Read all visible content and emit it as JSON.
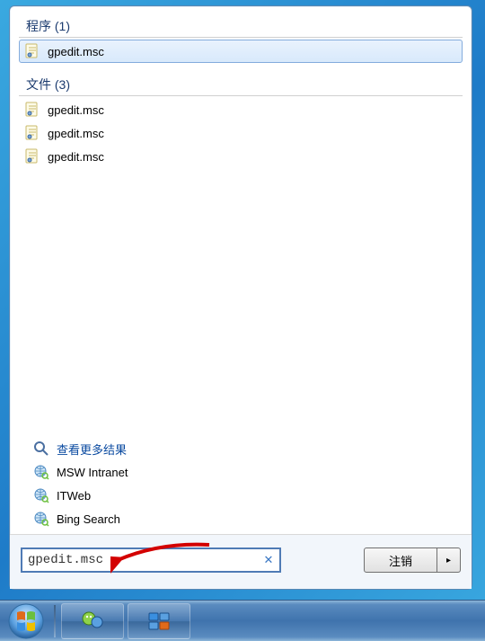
{
  "sections": {
    "programs": {
      "header": "程序 (1)",
      "items": [
        "gpedit.msc"
      ]
    },
    "files": {
      "header": "文件 (3)",
      "items": [
        "gpedit.msc",
        "gpedit.msc",
        "gpedit.msc"
      ]
    }
  },
  "bottom_links": {
    "more_results": "查看更多结果",
    "msw": "MSW Intranet",
    "itweb": "ITWeb",
    "bing": "Bing Search"
  },
  "search": {
    "value": "gpedit.msc"
  },
  "shutdown": {
    "label": "注销",
    "arrow": "▸"
  },
  "icon_colors": {
    "doc_bg": "#fdfbe8",
    "doc_border": "#c9b96a",
    "magnifier": "#4a6fa1",
    "web_globe": "#5aa0d8",
    "web_arrow": "#6bbf3d"
  }
}
